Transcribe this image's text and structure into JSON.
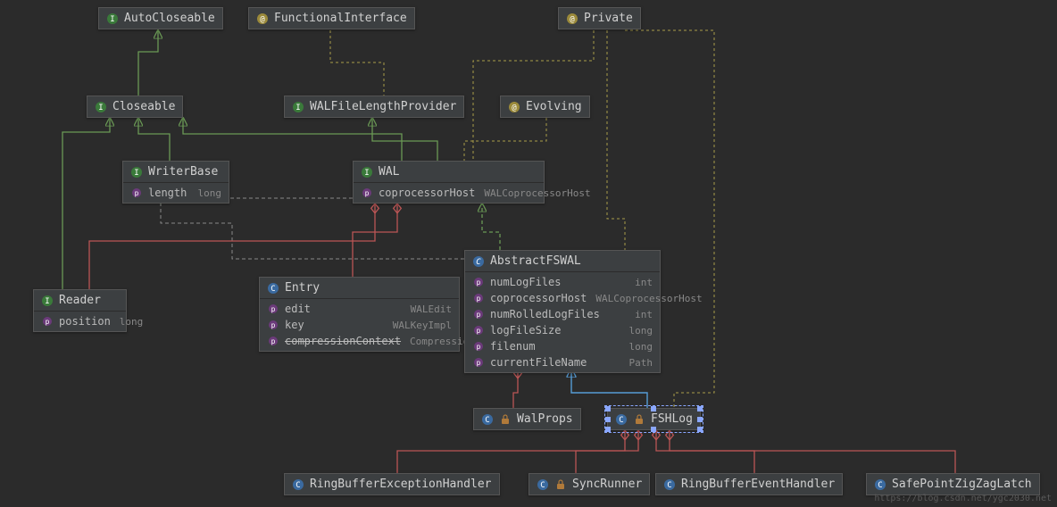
{
  "nodes": {
    "autoCloseable": {
      "title": "AutoCloseable"
    },
    "functionalInterface": {
      "title": "FunctionalInterface"
    },
    "private": {
      "title": "Private"
    },
    "closeable": {
      "title": "Closeable"
    },
    "walFileLengthProvider": {
      "title": "WALFileLengthProvider"
    },
    "evolving": {
      "title": "Evolving"
    },
    "writerBase": {
      "title": "WriterBase",
      "attrs": [
        {
          "name": "length",
          "type": "long"
        }
      ]
    },
    "wal": {
      "title": "WAL",
      "attrs": [
        {
          "name": "coprocessorHost",
          "type": "WALCoprocessorHost"
        }
      ]
    },
    "reader": {
      "title": "Reader",
      "attrs": [
        {
          "name": "position",
          "type": "long"
        }
      ]
    },
    "entry": {
      "title": "Entry",
      "attrs": [
        {
          "name": "edit",
          "type": "WALEdit"
        },
        {
          "name": "key",
          "type": "WALKeyImpl"
        },
        {
          "name": "compressionContext",
          "type": "CompressionContext",
          "strike": true
        }
      ]
    },
    "abstractFSWAL": {
      "title": "AbstractFSWAL",
      "attrs": [
        {
          "name": "numLogFiles",
          "type": "int"
        },
        {
          "name": "coprocessorHost",
          "type": "WALCoprocessorHost"
        },
        {
          "name": "numRolledLogFiles",
          "type": "int"
        },
        {
          "name": "logFileSize",
          "type": "long"
        },
        {
          "name": "filenum",
          "type": "long"
        },
        {
          "name": "currentFileName",
          "type": "Path"
        }
      ]
    },
    "walProps": {
      "title": "WalProps"
    },
    "fshLog": {
      "title": "FSHLog"
    },
    "ringBufferExceptionHandler": {
      "title": "RingBufferExceptionHandler"
    },
    "syncRunner": {
      "title": "SyncRunner"
    },
    "ringBufferEventHandler": {
      "title": "RingBufferEventHandler"
    },
    "safePointZigZagLatch": {
      "title": "SafePointZigZagLatch"
    }
  },
  "watermark": "https://blog.csdn.net/ygc2030.net",
  "icons": {
    "interface": "I",
    "class": "C",
    "property": "p",
    "lock": "L"
  }
}
